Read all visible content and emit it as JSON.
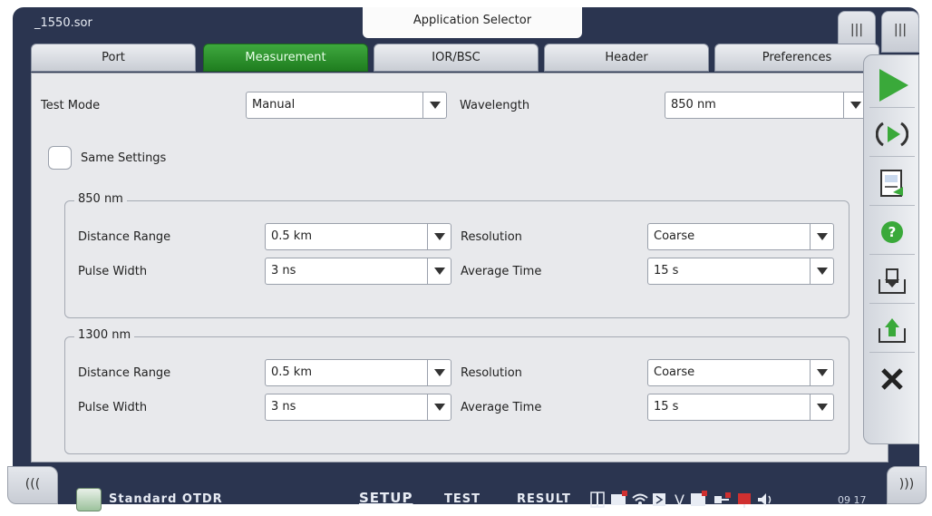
{
  "titlebar": {
    "filename": "_1550.sor",
    "app_selector": "Application Selector",
    "right_tab_1": "|||",
    "right_tab_2": "|||"
  },
  "tabs": [
    {
      "label": "Port",
      "active": false
    },
    {
      "label": "Measurement",
      "active": true
    },
    {
      "label": "IOR/BSC",
      "active": false
    },
    {
      "label": "Header",
      "active": false
    },
    {
      "label": "Preferences",
      "active": false
    }
  ],
  "measurement": {
    "test_mode_label": "Test Mode",
    "test_mode_value": "Manual",
    "wavelength_label": "Wavelength",
    "wavelength_value": "850 nm",
    "same_settings_label": "Same Settings",
    "same_settings_checked": false,
    "groups": [
      {
        "title": "850 nm",
        "distance_range_label": "Distance Range",
        "distance_range_value": "0.5 km",
        "resolution_label": "Resolution",
        "resolution_value": "Coarse",
        "pulse_width_label": "Pulse Width",
        "pulse_width_value": "3 ns",
        "average_time_label": "Average Time",
        "average_time_value": "15 s"
      },
      {
        "title": "1300 nm",
        "distance_range_label": "Distance Range",
        "distance_range_value": "0.5 km",
        "resolution_label": "Resolution",
        "resolution_value": "Coarse",
        "pulse_width_label": "Pulse Width",
        "pulse_width_value": "3 ns",
        "average_time_label": "Average Time",
        "average_time_value": "15 s"
      }
    ]
  },
  "sidebar": {
    "icons": [
      "play-icon",
      "repeat-play-icon",
      "report-icon",
      "help-icon",
      "save-icon",
      "load-icon",
      "close-icon"
    ]
  },
  "bottombar": {
    "left_arrow": "(((",
    "right_arrow": ")))",
    "app_name": "Standard OTDR",
    "nav_setup": "SETUP",
    "nav_test": "TEST",
    "nav_result": "RESULT",
    "status_v": "V",
    "clock": "09 17"
  },
  "colors": {
    "frame": "#2b3550",
    "active_tab": "#2a8f2a",
    "play_green": "#3aa93a"
  }
}
